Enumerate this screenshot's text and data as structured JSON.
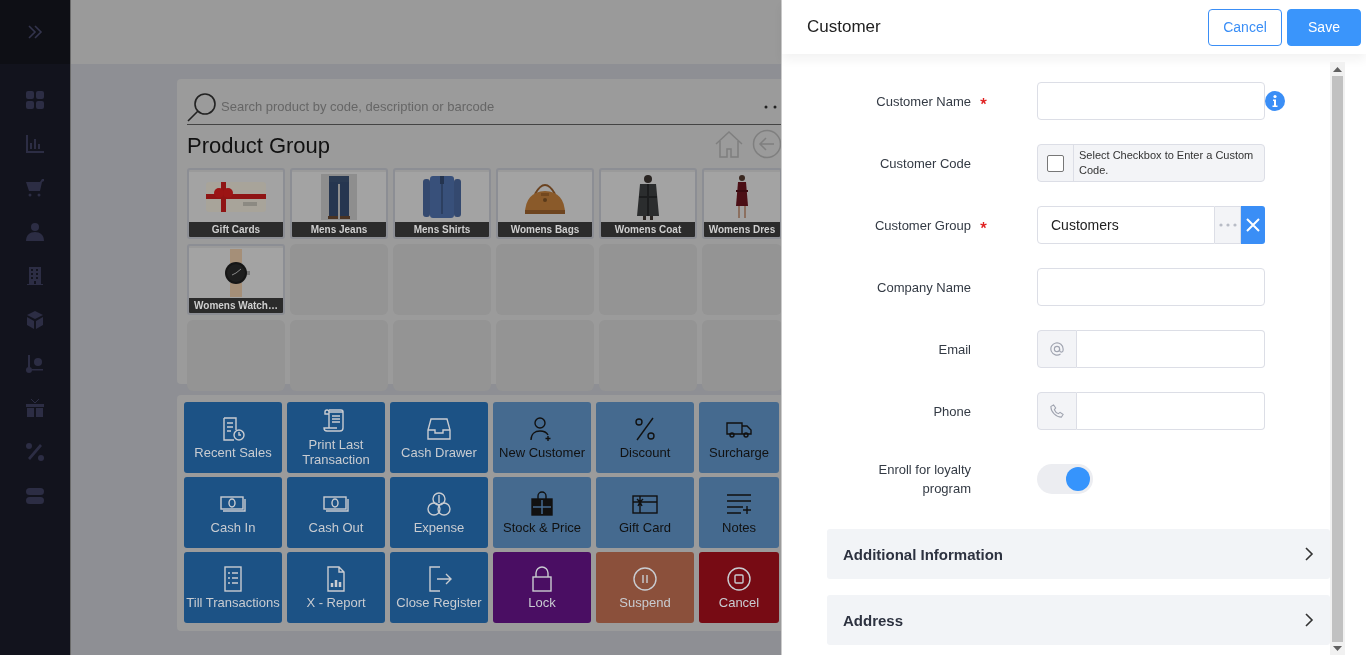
{
  "search": {
    "placeholder": "Search product by code, description or barcode"
  },
  "product_group": {
    "title": "Product Group",
    "tiles": [
      {
        "label": "Gift Cards",
        "kind": "picture"
      },
      {
        "label": "Mens Jeans",
        "kind": "picture"
      },
      {
        "label": "Mens Shirts",
        "kind": "picture"
      },
      {
        "label": "Womens Bags",
        "kind": "picture"
      },
      {
        "label": "Womens Coat",
        "kind": "picture"
      },
      {
        "label": "Womens Dres",
        "kind": "picture"
      },
      {
        "label": "Womens Watch…",
        "kind": "picture"
      }
    ]
  },
  "actions": [
    {
      "label": "Recent Sales",
      "kind": "register",
      "color": "#1c5285"
    },
    {
      "label": "Print Last Transaction",
      "kind": "register",
      "color": "#1c5285"
    },
    {
      "label": "Cash Drawer",
      "kind": "register",
      "color": "#1c5285"
    },
    {
      "label": "New Customer",
      "kind": "sale",
      "color": "#456a8f"
    },
    {
      "label": "Discount",
      "kind": "sale",
      "color": "#456a8f"
    },
    {
      "label": "Surcharge",
      "kind": "sale",
      "color": "#456a8f"
    },
    {
      "label": "Cash In",
      "kind": "register",
      "color": "#1c5285"
    },
    {
      "label": "Cash Out",
      "kind": "register",
      "color": "#1c5285"
    },
    {
      "label": "Expense",
      "kind": "register",
      "color": "#1c5285"
    },
    {
      "label": "Stock & Price",
      "kind": "sale",
      "color": "#456a8f"
    },
    {
      "label": "Gift Card",
      "kind": "sale",
      "color": "#456a8f"
    },
    {
      "label": "Notes",
      "kind": "sale",
      "color": "#456a8f"
    },
    {
      "label": "Till Transactions",
      "kind": "register",
      "color": "#1c5285"
    },
    {
      "label": "X - Report",
      "kind": "register",
      "color": "#1c5285"
    },
    {
      "label": "Close Register",
      "kind": "register",
      "color": "#1c5285"
    },
    {
      "label": "Lock",
      "kind": "register",
      "color": "#4a0e63"
    },
    {
      "label": "Suspend",
      "kind": "register",
      "color": "#8b503b"
    },
    {
      "label": "Cancel",
      "kind": "register",
      "color": "#770b14"
    }
  ],
  "customer_form": {
    "title": "Customer",
    "buttons": [
      {
        "label": "Cancel",
        "kind": "outline"
      },
      {
        "label": "Save",
        "kind": "primary"
      }
    ],
    "fields": [
      {
        "label": "Customer Name",
        "required": true,
        "kind": "text"
      },
      {
        "label": "Customer Code",
        "required": false,
        "kind": "checkbox",
        "checked": false,
        "hint": "Select Checkbox to Enter a Custom Code."
      },
      {
        "label": "Customer Group",
        "required": true,
        "kind": "lookup",
        "value": "Customers"
      },
      {
        "label": "Company Name",
        "required": false,
        "kind": "text"
      },
      {
        "label": "Email",
        "required": false,
        "kind": "email"
      },
      {
        "label": "Phone",
        "required": false,
        "kind": "phone"
      },
      {
        "label": "Enroll for loyalty program",
        "required": false,
        "kind": "toggle",
        "on": true
      }
    ],
    "sections": [
      {
        "label": "Additional Information",
        "expanded": false
      },
      {
        "label": "Address",
        "expanded": false
      }
    ]
  }
}
